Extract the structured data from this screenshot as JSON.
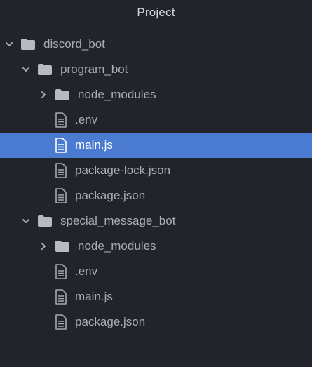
{
  "panel": {
    "title": "Project"
  },
  "tree": [
    {
      "label": "discord_bot",
      "type": "folder",
      "expanded": true,
      "depth": 0
    },
    {
      "label": "program_bot",
      "type": "folder",
      "expanded": true,
      "depth": 1
    },
    {
      "label": "node_modules",
      "type": "folder",
      "expanded": false,
      "depth": 2
    },
    {
      "label": ".env",
      "type": "file",
      "depth": 2
    },
    {
      "label": "main.js",
      "type": "file",
      "depth": 2,
      "selected": true
    },
    {
      "label": "package-lock.json",
      "type": "file",
      "depth": 2
    },
    {
      "label": "package.json",
      "type": "file",
      "depth": 2
    },
    {
      "label": "special_message_bot",
      "type": "folder",
      "expanded": true,
      "depth": 1
    },
    {
      "label": "node_modules",
      "type": "folder",
      "expanded": false,
      "depth": 2
    },
    {
      "label": ".env",
      "type": "file",
      "depth": 2
    },
    {
      "label": "main.js",
      "type": "file",
      "depth": 2
    },
    {
      "label": "package.json",
      "type": "file",
      "depth": 2
    }
  ],
  "colors": {
    "background": "#21252b",
    "selection": "#4a7bd0",
    "text": "#a8adb6",
    "title": "#d3d6dc",
    "icon": "#a3a8b1"
  },
  "icons": {
    "folder": "folder-icon",
    "file": "file-text-icon",
    "expanded": "chevron-down-icon",
    "collapsed": "chevron-right-icon"
  }
}
